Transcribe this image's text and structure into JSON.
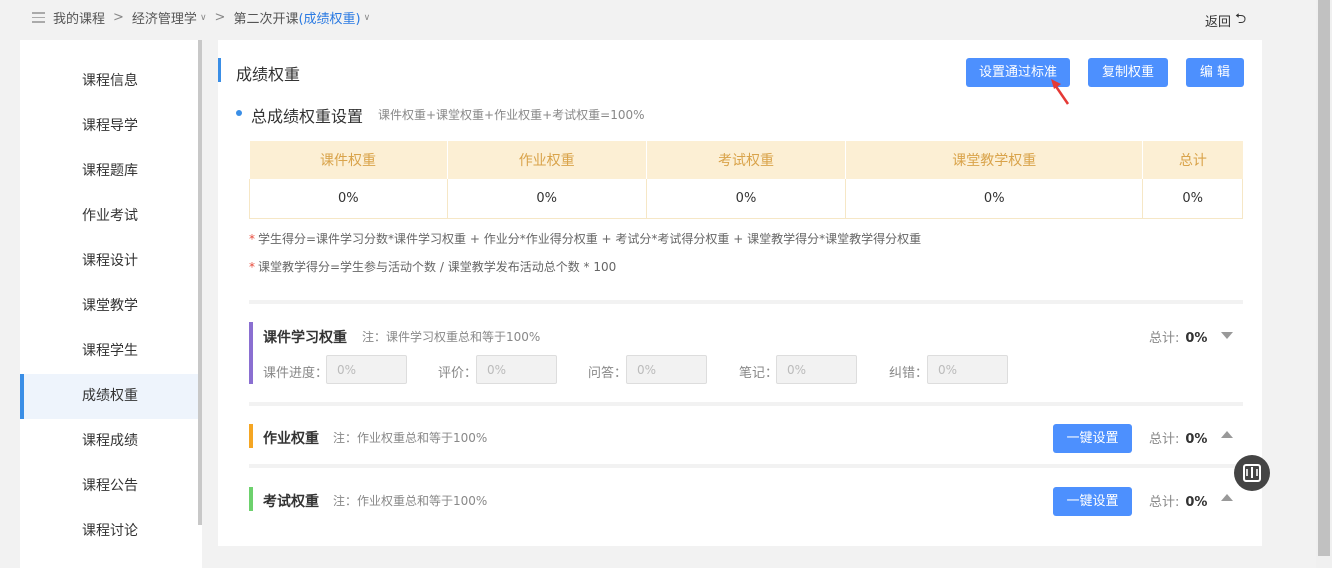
{
  "breadcrumb": {
    "root": "我的课程",
    "course": "经济管理学",
    "session_prefix": "第二次开课",
    "session_highlight": "(成绩权重)",
    "back_label": "返回"
  },
  "sidebar": {
    "items": [
      {
        "label": "课程信息"
      },
      {
        "label": "课程导学"
      },
      {
        "label": "课程题库"
      },
      {
        "label": "作业考试"
      },
      {
        "label": "课程设计"
      },
      {
        "label": "课堂教学"
      },
      {
        "label": "课程学生"
      },
      {
        "label": "成绩权重",
        "active": true
      },
      {
        "label": "课程成绩"
      },
      {
        "label": "课程公告"
      },
      {
        "label": "课程讨论"
      }
    ]
  },
  "main": {
    "title": "成绩权重",
    "buttons": {
      "set_pass": "设置通过标准",
      "copy": "复制权重",
      "edit": "编 辑"
    },
    "overall": {
      "title": "总成绩权重设置",
      "note": "课件权重+课堂权重+作业权重+考试权重=100%",
      "headers": [
        "课件权重",
        "作业权重",
        "考试权重",
        "课堂教学权重",
        "总计"
      ],
      "values": [
        "0%",
        "0%",
        "0%",
        "0%",
        "0%"
      ]
    },
    "formulas": [
      "学生得分=课件学习分数*课件学习权重 + 作业分*作业得分权重 + 考试分*考试得分权重 + 课堂教学得分*课堂教学得分权重",
      "课堂教学得分=学生参与活动个数 / 课堂教学发布活动总个数 * 100"
    ],
    "courseware": {
      "title": "课件学习权重",
      "note": "注：课件学习权重总和等于100%",
      "total_label": "总计:",
      "total_value": "0%",
      "fields": [
        {
          "label": "课件进度：",
          "placeholder": "0%"
        },
        {
          "label": "评价：",
          "placeholder": "0%"
        },
        {
          "label": "问答：",
          "placeholder": "0%"
        },
        {
          "label": "笔记：",
          "placeholder": "0%"
        },
        {
          "label": "纠错：",
          "placeholder": "0%"
        }
      ]
    },
    "homework": {
      "title": "作业权重",
      "note": "注：作业权重总和等于100%",
      "button": "一键设置",
      "total_label": "总计:",
      "total_value": "0%"
    },
    "exam": {
      "title": "考试权重",
      "note": "注：作业权重总和等于100%",
      "button": "一键设置",
      "total_label": "总计:",
      "total_value": "0%"
    }
  },
  "colors": {
    "accent": "#4d90fe",
    "courseware_bar": "#8a6fd1",
    "homework_bar": "#f5a623",
    "exam_bar": "#6dd16d",
    "table_header_bg": "#fcefd4",
    "table_header_text": "#d9a34a",
    "annotation_arrow": "#e53935"
  }
}
